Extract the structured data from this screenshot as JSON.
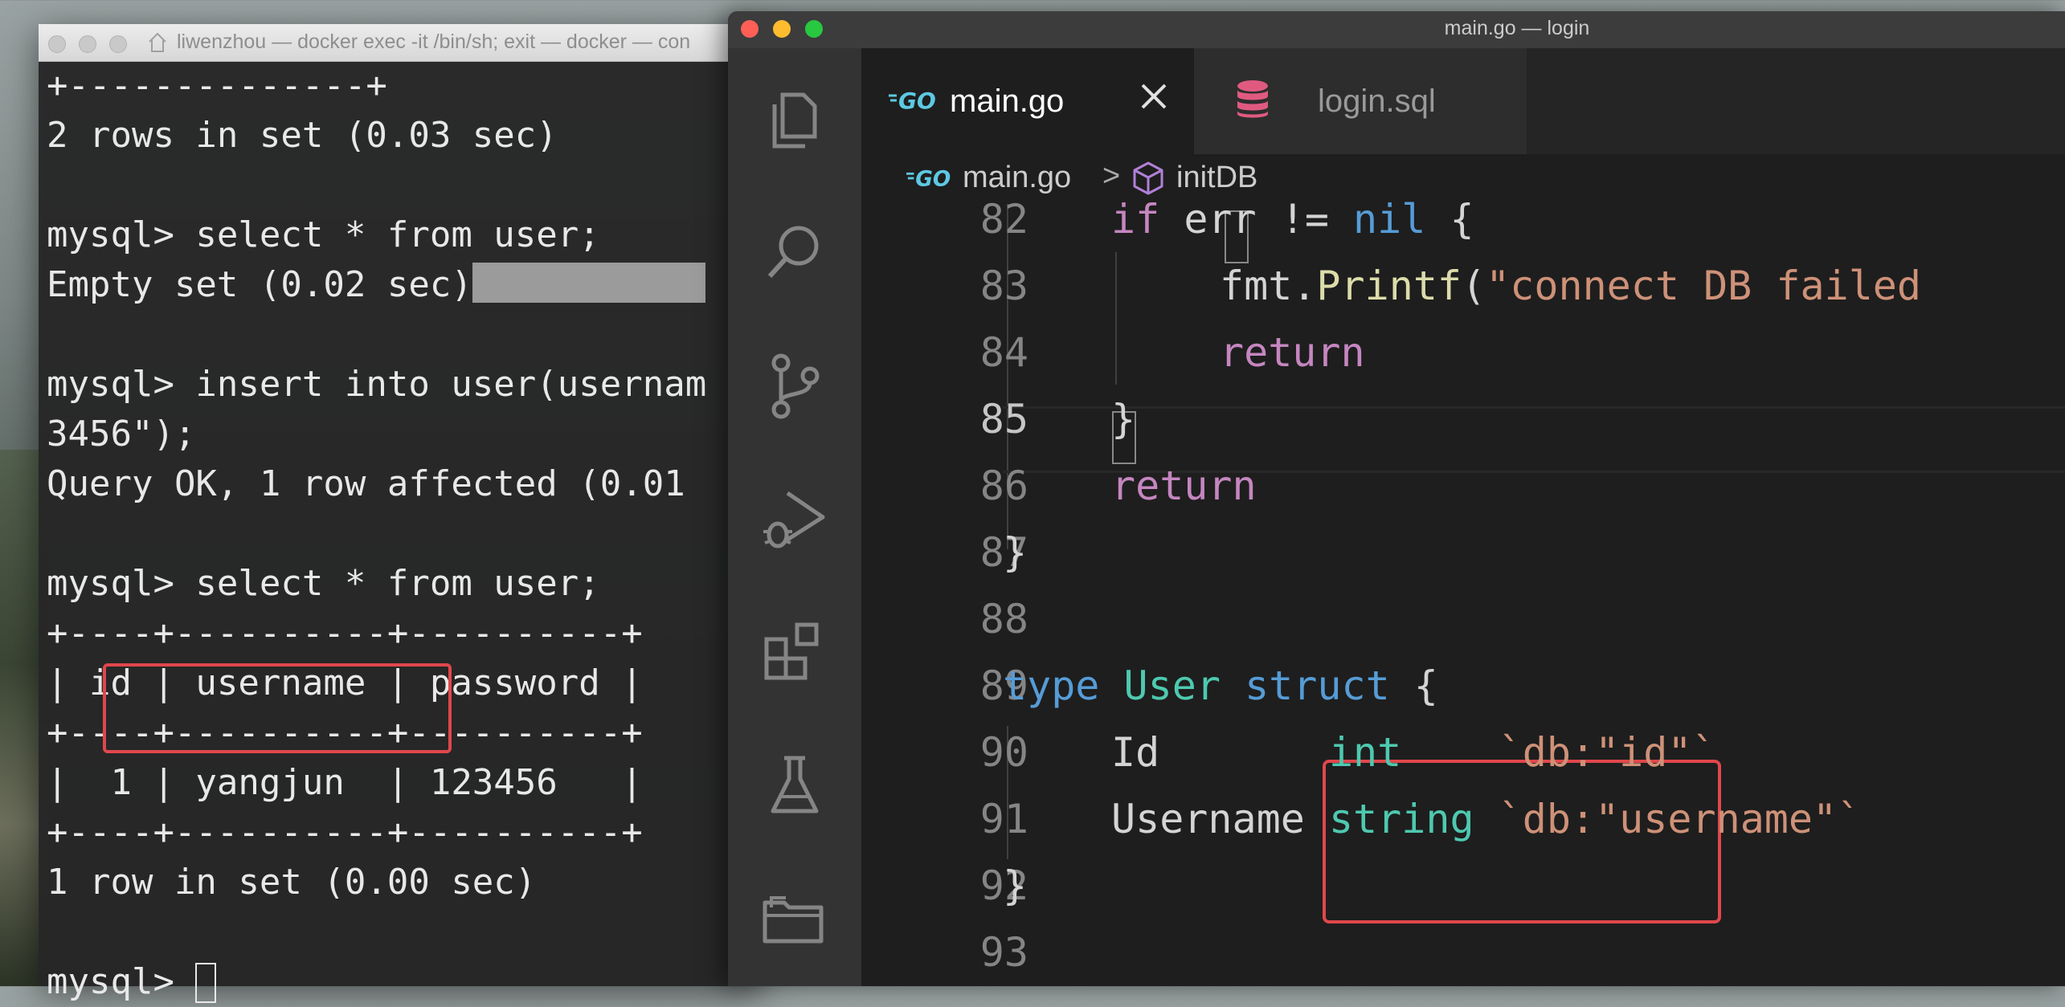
{
  "terminal": {
    "title": "liwenzhou — docker exec -it  /bin/sh; exit — docker — con",
    "lines": [
      "+--------------+",
      "2 rows in set (0.03 sec)",
      "",
      "mysql> select * from user;",
      "Empty set (0.02 sec)",
      "",
      "mysql> insert into user(usernam",
      "3456\");",
      "Query OK, 1 row affected (0.01",
      "",
      "mysql> select * from user;",
      "+----+----------+----------+",
      "| id | username | password |",
      "+----+----------+----------+",
      "|  1 | yangjun  | 123456   |",
      "+----+----------+----------+",
      "1 row in set (0.00 sec)",
      "",
      "mysql> "
    ]
  },
  "vscode": {
    "window_title": "main.go — login",
    "traffic_lights": {
      "close": "#ff5f57",
      "minimize": "#febc2e",
      "maximize": "#28c840"
    },
    "activity_bar": [
      "explorer-icon",
      "search-icon",
      "source-control-icon",
      "run-debug-icon",
      "extensions-icon",
      "testing-icon",
      "remote-explorer-icon"
    ],
    "tabs": [
      {
        "label": "main.go",
        "icon": "go-file-icon",
        "active": true
      },
      {
        "label": "login.sql",
        "icon": "database-icon",
        "active": false
      }
    ],
    "go_badge": "GO",
    "breadcrumb": {
      "file": "main.go",
      "separator": ">",
      "symbol": "initDB"
    },
    "code": {
      "current_line": "85",
      "lines": [
        {
          "num": "82",
          "tokens": [
            [
              "kw-purple",
              "if"
            ],
            [
              "plain",
              " err != "
            ],
            [
              "kw-blue",
              "nil"
            ],
            [
              "plain",
              " {"
            ]
          ]
        },
        {
          "num": "83",
          "tokens": [
            [
              "plain",
              "fmt."
            ],
            [
              "fn-yellow",
              "Printf"
            ],
            [
              "plain",
              "("
            ],
            [
              "str",
              "\"connect DB failed"
            ]
          ]
        },
        {
          "num": "84",
          "tokens": [
            [
              "kw-purple",
              "return"
            ]
          ]
        },
        {
          "num": "85",
          "tokens": [
            [
              "plain",
              "}"
            ]
          ]
        },
        {
          "num": "86",
          "tokens": [
            [
              "kw-purple",
              "return"
            ]
          ]
        },
        {
          "num": "87",
          "tokens": [
            [
              "plain",
              "}"
            ]
          ]
        },
        {
          "num": "88",
          "tokens": []
        },
        {
          "num": "89",
          "tokens": [
            [
              "kw-blue",
              "type"
            ],
            [
              "plain",
              " "
            ],
            [
              "type-teal",
              "User"
            ],
            [
              "plain",
              " "
            ],
            [
              "kw-blue",
              "struct"
            ],
            [
              "plain",
              " {"
            ]
          ]
        },
        {
          "num": "90",
          "tokens": [
            [
              "plain",
              "Id       "
            ],
            [
              "type-teal",
              "int"
            ],
            [
              "plain",
              "    "
            ],
            [
              "str",
              "`db:\"id\"`"
            ]
          ]
        },
        {
          "num": "91",
          "tokens": [
            [
              "plain",
              "Username "
            ],
            [
              "type-teal",
              "string"
            ],
            [
              "plain",
              " "
            ],
            [
              "str",
              "`db:\"username\"`"
            ]
          ]
        },
        {
          "num": "92",
          "tokens": [
            [
              "plain",
              "}"
            ]
          ]
        },
        {
          "num": "93",
          "tokens": []
        }
      ]
    }
  }
}
